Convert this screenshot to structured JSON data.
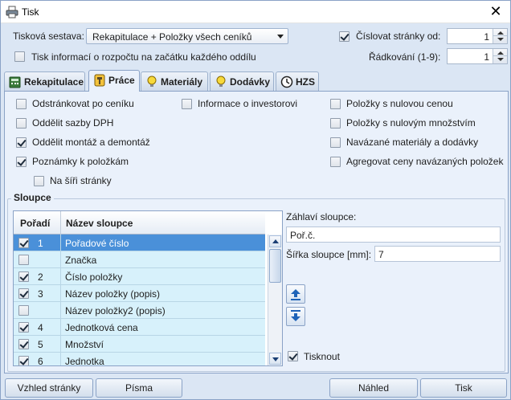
{
  "window": {
    "title": "Tisk",
    "close_icon": "close-icon"
  },
  "top": {
    "report_label": "Tisková sestava:",
    "report_value": "Rekapitulace + Položky všech ceníků",
    "budget_info_label": "Tisk informací o rozpočtu na začátku každého oddílu",
    "budget_info_checked": false,
    "number_pages_label": "Číslovat stránky od:",
    "number_pages_checked": true,
    "number_pages_value": "1",
    "line_spacing_label": "Řádkování (1-9):",
    "line_spacing_value": "1"
  },
  "tabs": [
    {
      "label": "Rekapitulace",
      "icon": "calculator-icon"
    },
    {
      "label": "Práce",
      "icon": "hammer-icon",
      "active": true
    },
    {
      "label": "Materiály",
      "icon": "lightbulb-icon"
    },
    {
      "label": "Dodávky",
      "icon": "lightbulb-icon"
    },
    {
      "label": "HZS",
      "icon": "clock-icon"
    }
  ],
  "options": {
    "col1": [
      {
        "label": "Odstránkovat po ceníku",
        "checked": false
      },
      {
        "label": "Oddělit sazby DPH",
        "checked": false
      },
      {
        "label": "Oddělit montáž a demontáž",
        "checked": true
      },
      {
        "label": "Poznámky k položkám",
        "checked": true
      },
      {
        "label": "Na šíři stránky",
        "checked": false
      }
    ],
    "col2": [
      {
        "label": "Informace o investorovi",
        "checked": false
      }
    ],
    "col3": [
      {
        "label": "Položky s nulovou cenou",
        "checked": false
      },
      {
        "label": "Položky s nulovým množstvím",
        "checked": false
      },
      {
        "label": "Navázané materiály a dodávky",
        "checked": false
      },
      {
        "label": "Agregovat ceny navázaných položek",
        "checked": false
      }
    ]
  },
  "columns": {
    "group_title": "Sloupce",
    "header_order": "Pořadí",
    "header_name": "Název sloupce",
    "rows": [
      {
        "checked": true,
        "order": "1",
        "name": "Pořadové číslo",
        "selected": true
      },
      {
        "checked": false,
        "order": "",
        "name": "Značka"
      },
      {
        "checked": true,
        "order": "2",
        "name": "Číslo položky"
      },
      {
        "checked": true,
        "order": "3",
        "name": "Název položky (popis)"
      },
      {
        "checked": false,
        "order": "",
        "name": "Název položky2 (popis)"
      },
      {
        "checked": true,
        "order": "4",
        "name": "Jednotková cena"
      },
      {
        "checked": true,
        "order": "5",
        "name": "Množství"
      },
      {
        "checked": true,
        "order": "6",
        "name": "Jednotka"
      }
    ],
    "header_caption_label": "Záhlaví sloupce:",
    "header_caption_value": "Poř.č.",
    "width_label": "Šířka sloupce [mm]:",
    "width_value": "7",
    "print_label": "Tisknout",
    "print_checked": true
  },
  "buttons": {
    "page_look": "Vzhled stránky",
    "fonts": "Písma",
    "preview": "Náhled",
    "print": "Tisk"
  }
}
